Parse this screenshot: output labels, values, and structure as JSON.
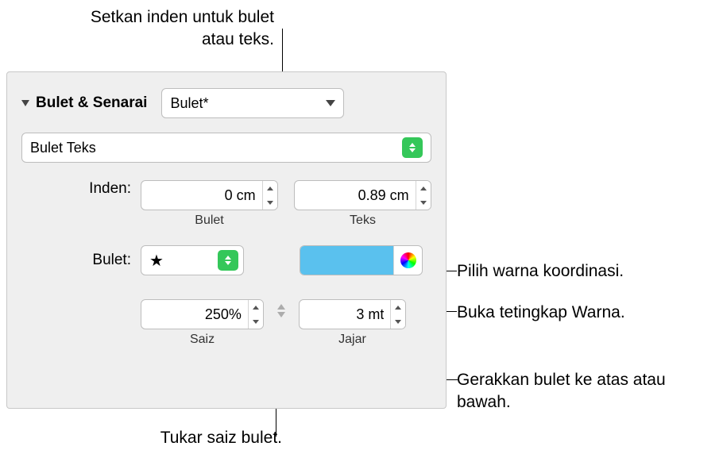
{
  "callouts": {
    "top": "Setkan inden untuk bulet atau teks.",
    "right1": "Pilih warna koordinasi.",
    "right2": "Buka tetingkap Warna.",
    "right3": "Gerakkan bulet ke atas atau bawah.",
    "bottom": "Tukar saiz bulet."
  },
  "panel": {
    "section_title": "Bulet & Senarai",
    "style_select": "Bulet*",
    "bullet_type_select": "Bulet Teks",
    "indent_label": "Inden:",
    "indent_bullet_value": "0 cm",
    "indent_bullet_sublabel": "Bulet",
    "indent_text_value": "0.89 cm",
    "indent_text_sublabel": "Teks",
    "bullet_label": "Bulet:",
    "bullet_glyph": "★",
    "size_value": "250%",
    "size_sublabel": "Saiz",
    "align_value": "3 mt",
    "align_sublabel": "Jajar",
    "swatch_color": "#5ac1ee"
  }
}
